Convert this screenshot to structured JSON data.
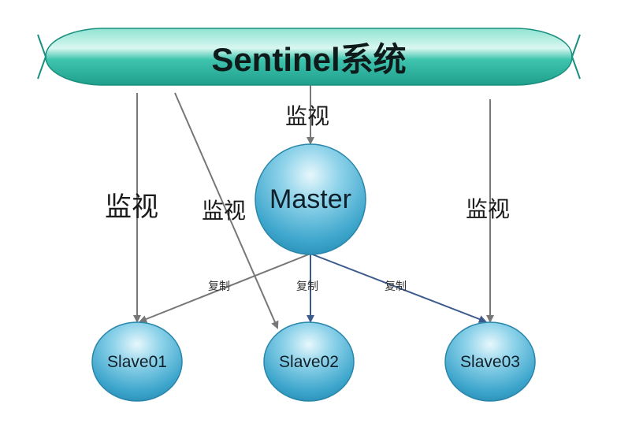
{
  "banner": {
    "title": "Sentinel系统"
  },
  "labels": {
    "monitor_master": "监视",
    "monitor_slave01": "监视",
    "monitor_slave02": "监视",
    "monitor_slave03": "监视",
    "replicate_slave01": "复制",
    "replicate_slave02": "复制",
    "replicate_slave03": "复制"
  },
  "nodes": {
    "master": "Master",
    "slave01": "Slave01",
    "slave02": "Slave02",
    "slave03": "Slave03"
  },
  "colors": {
    "banner_fill": "#2fbfa8",
    "banner_highlight": "#b8efe3",
    "node_fill": "#4fb3d4",
    "node_highlight": "#dff4fb",
    "monitor_arrow": "#777777",
    "replicate_arrow_gray": "#777777",
    "replicate_arrow_blue": "#3c5a8c"
  }
}
